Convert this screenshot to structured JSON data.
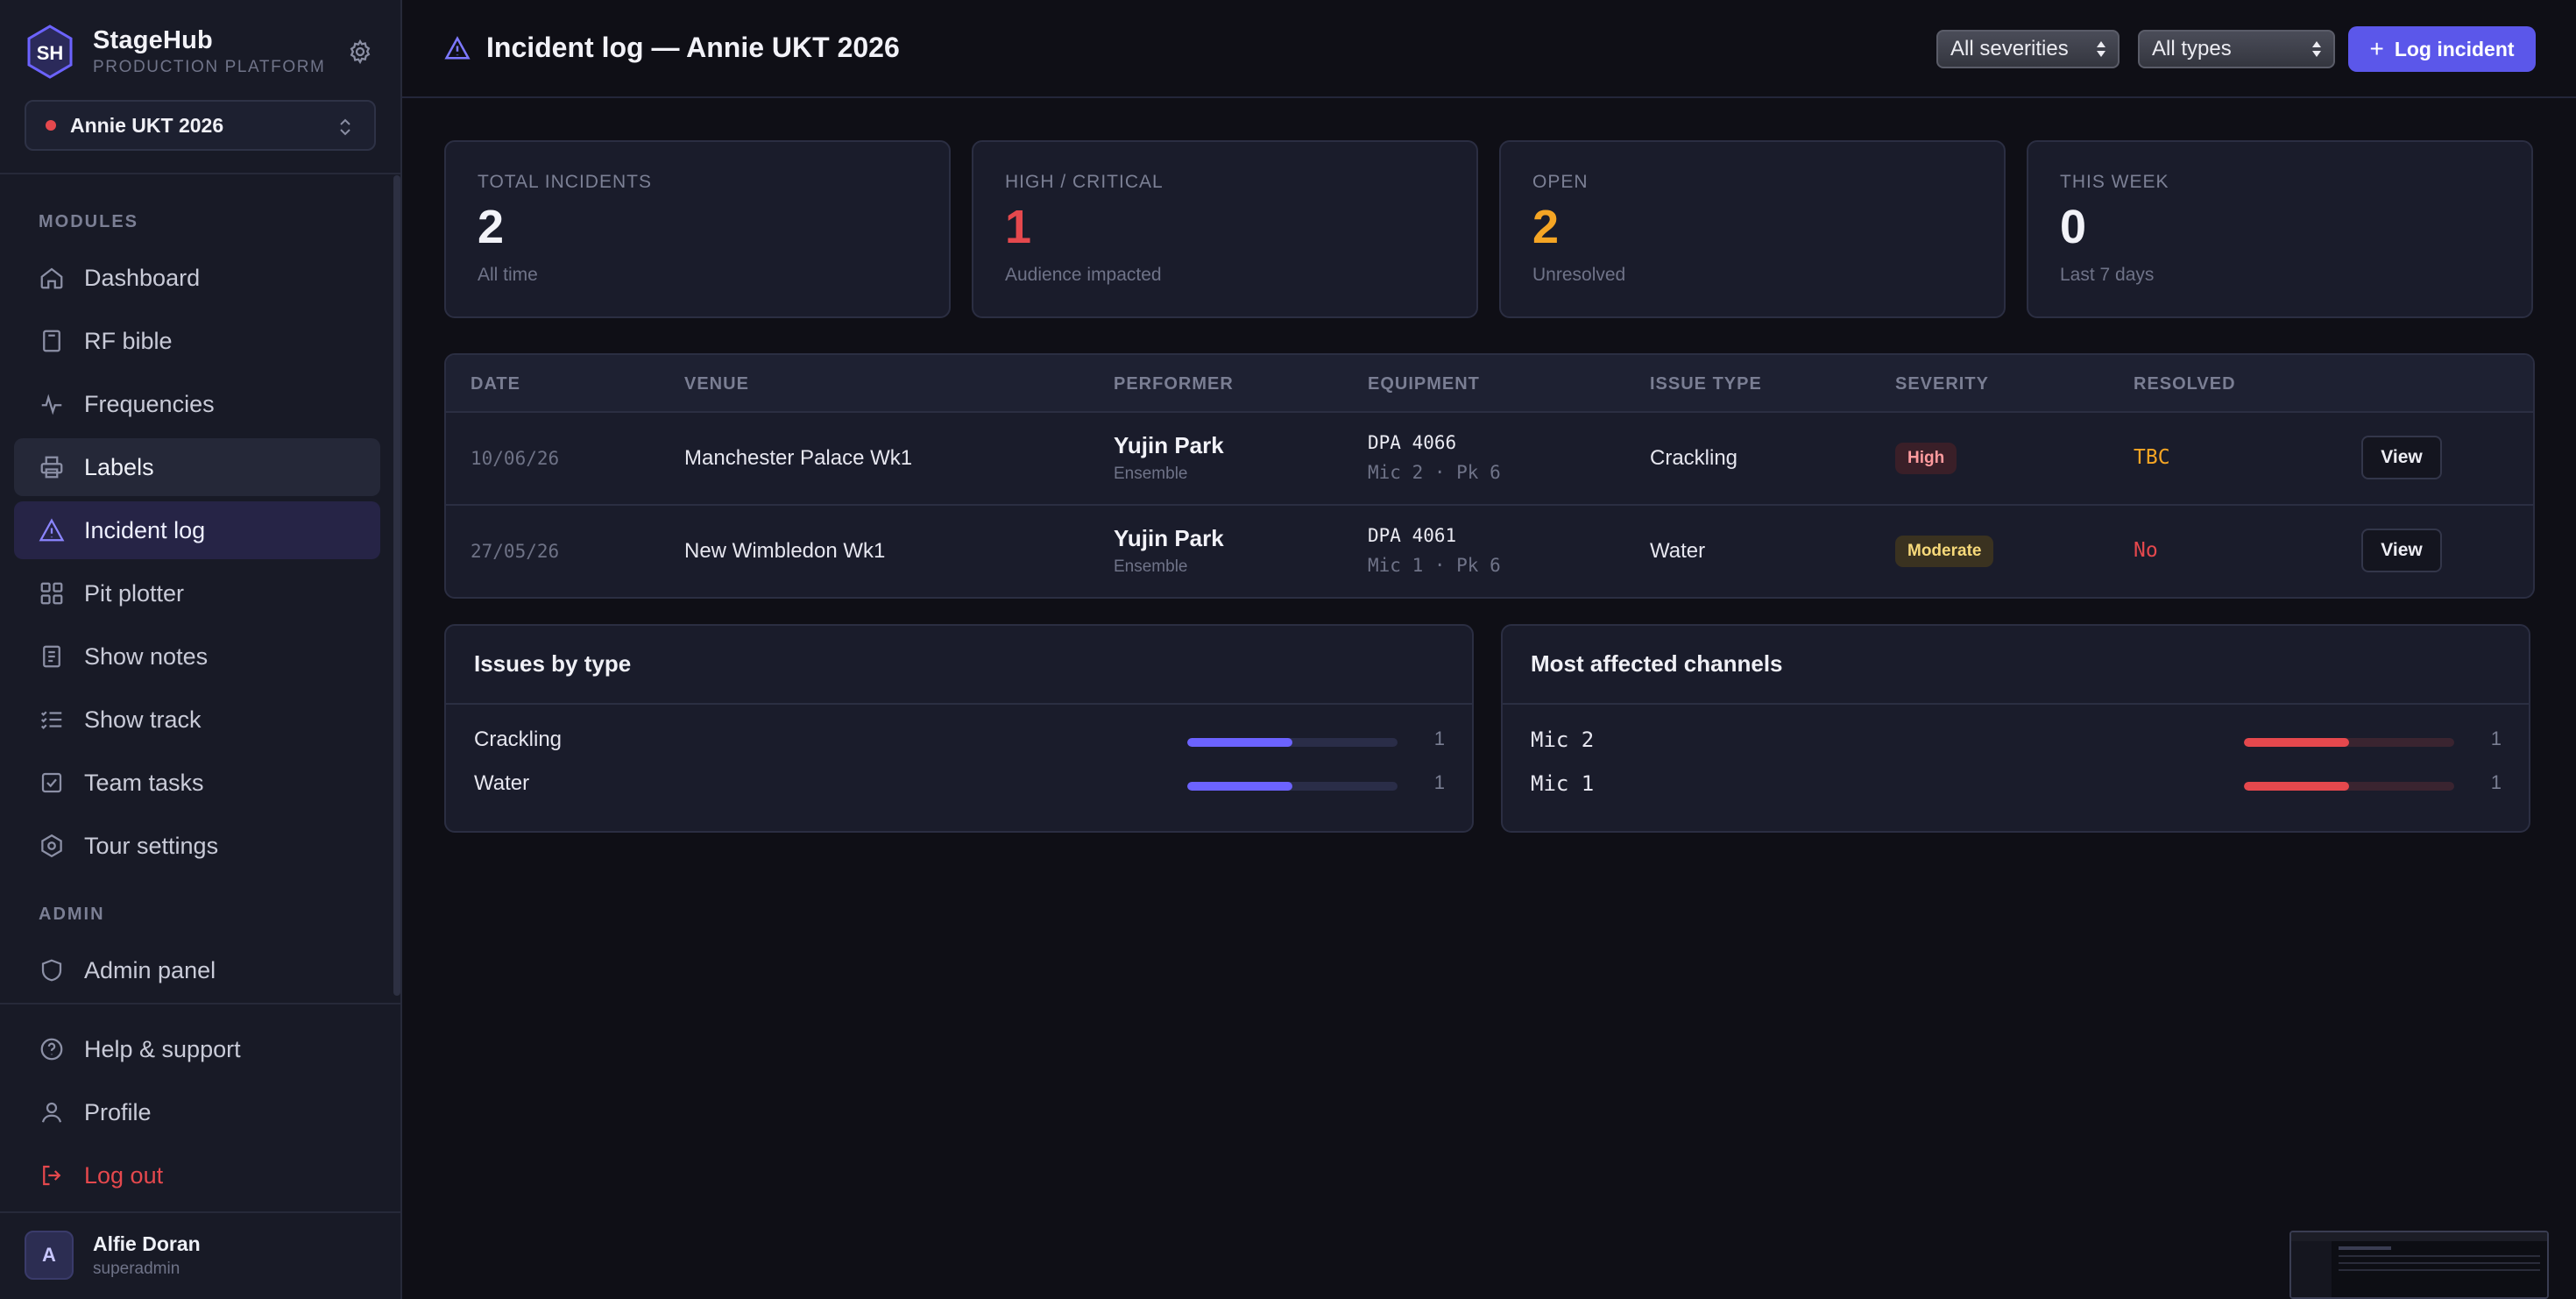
{
  "brand": {
    "initials": "SH",
    "name": "StageHub",
    "subtitle": "PRODUCTION PLATFORM"
  },
  "tour": {
    "name": "Annie UKT 2026",
    "status_color": "#e5484d"
  },
  "sidebar": {
    "modules_label": "MODULES",
    "admin_label": "ADMIN",
    "items": [
      {
        "label": "Dashboard",
        "icon": "home-icon"
      },
      {
        "label": "RF bible",
        "icon": "book-icon"
      },
      {
        "label": "Frequencies",
        "icon": "pulse-icon"
      },
      {
        "label": "Labels",
        "icon": "printer-icon"
      },
      {
        "label": "Incident log",
        "icon": "warning-icon"
      },
      {
        "label": "Pit plotter",
        "icon": "grid-icon"
      },
      {
        "label": "Show notes",
        "icon": "notes-icon"
      },
      {
        "label": "Show track",
        "icon": "list-check-icon"
      },
      {
        "label": "Team tasks",
        "icon": "checkbox-icon"
      },
      {
        "label": "Tour settings",
        "icon": "settings-icon"
      }
    ],
    "admin_items": [
      {
        "label": "Admin panel",
        "icon": "shield-icon"
      }
    ],
    "bottom_items": [
      {
        "label": "Help & support",
        "icon": "help-icon"
      },
      {
        "label": "Profile",
        "icon": "user-icon"
      },
      {
        "label": "Log out",
        "icon": "logout-icon"
      }
    ]
  },
  "user": {
    "initial": "A",
    "name": "Alfie Doran",
    "role": "superadmin"
  },
  "header": {
    "title": "Incident log — Annie UKT 2026",
    "severity_filter": "All severities",
    "type_filter": "All types",
    "log_button": "Log incident"
  },
  "stats": [
    {
      "label": "TOTAL INCIDENTS",
      "value": "2",
      "sub": "All time",
      "color": "#f2f2f8"
    },
    {
      "label": "HIGH / CRITICAL",
      "value": "1",
      "sub": "Audience impacted",
      "color": "#e5484d"
    },
    {
      "label": "OPEN",
      "value": "2",
      "sub": "Unresolved",
      "color": "#f5a524"
    },
    {
      "label": "THIS WEEK",
      "value": "0",
      "sub": "Last 7 days",
      "color": "#f2f2f8"
    }
  ],
  "table": {
    "columns": [
      "DATE",
      "VENUE",
      "PERFORMER",
      "EQUIPMENT",
      "ISSUE TYPE",
      "SEVERITY",
      "RESOLVED"
    ],
    "view_label": "View",
    "rows": [
      {
        "date": "10/06/26",
        "venue": "Manchester Palace Wk1",
        "performer": "Yujin Park",
        "group": "Ensemble",
        "equipment": "DPA 4066",
        "equipment_sub": "Mic 2 · Pk 6",
        "issue": "Crackling",
        "severity": "High",
        "resolved": "TBC",
        "resolved_color": "#f5a524"
      },
      {
        "date": "27/05/26",
        "venue": "New Wimbledon Wk1",
        "performer": "Yujin Park",
        "group": "Ensemble",
        "equipment": "DPA 4061",
        "equipment_sub": "Mic 1 · Pk 6",
        "issue": "Water",
        "severity": "Moderate",
        "resolved": "No",
        "resolved_color": "#e5484d"
      }
    ]
  },
  "issues_by_type": {
    "title": "Issues by type",
    "bar_color": "#6c63ff",
    "items": [
      {
        "label": "Crackling",
        "count": "1",
        "fraction": 0.5
      },
      {
        "label": "Water",
        "count": "1",
        "fraction": 0.5
      }
    ]
  },
  "most_affected": {
    "title": "Most affected channels",
    "bar_color": "#e5484d",
    "items": [
      {
        "label": "Mic 2",
        "count": "1",
        "fraction": 0.5
      },
      {
        "label": "Mic 1",
        "count": "1",
        "fraction": 0.5
      }
    ]
  }
}
